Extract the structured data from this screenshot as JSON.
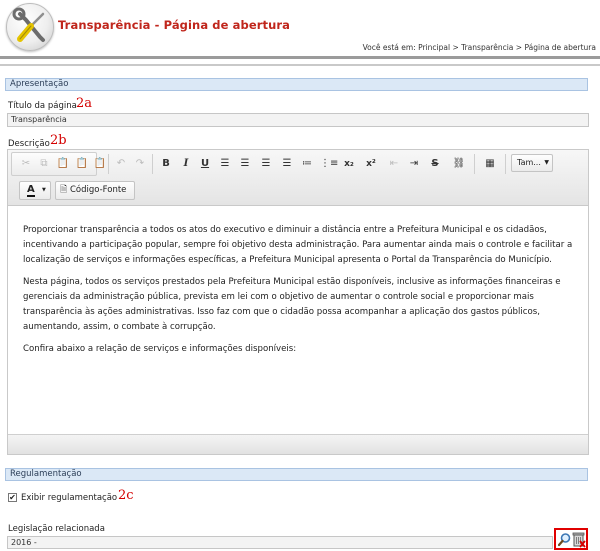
{
  "header": {
    "title": "Transparência - Página de abertura",
    "breadcrumb": "Você está em: Principal > Transparência > Página de abertura"
  },
  "sections": {
    "apresentacao": "Apresentação",
    "regulamentacao": "Regulamentação"
  },
  "titulo": {
    "label": "Título da página",
    "value": "Transparência",
    "annotation": "2a"
  },
  "descricao": {
    "label": "Descrição",
    "annotation": "2b"
  },
  "toolbar": {
    "font_size_label": "Tam...",
    "source_label": "Código-Fonte",
    "font_color_label": "A"
  },
  "content": {
    "p1": "Proporcionar transparência a todos os atos do executivo e diminuir a distância entre a Prefeitura Municipal e os cidadãos, incentivando a participação popular, sempre foi objetivo desta administração. Para aumentar ainda mais o controle e facilitar a localização de serviços e informações específicas, a Prefeitura Municipal apresenta o Portal da Transparência do Município.",
    "p2": "Nesta página, todos os serviços prestados pela Prefeitura Municipal estão disponíveis, inclusive as informações financeiras e gerenciais da administração pública, prevista em lei com o objetivo de aumentar o controle social e proporcionar mais transparência às ações administrativas. Isso faz com que o cidadão possa acompanhar a aplicação dos gastos públicos, aumentando, assim, o combate à corrupção.",
    "p3": "Confira abaixo a relação de serviços e informações disponíveis:"
  },
  "regulamentacao": {
    "checkbox_label": "Exibir regulamentação",
    "checked": true,
    "annotation": "2c",
    "legislacao_label": "Legislação relacionada",
    "legislacao_value": "2016 -"
  },
  "colors": {
    "title": "#c0261c",
    "section_bar": "#dbe8f6",
    "annotation": "#d40000",
    "highlight_box": "#e00000"
  },
  "icons": [
    "tools-icon",
    "cut-icon",
    "copy-icon",
    "paste-icon",
    "paste-text-icon",
    "paste-word-icon",
    "undo-icon",
    "redo-icon",
    "bold-icon",
    "italic-icon",
    "underline-icon",
    "align-left-icon",
    "align-center-icon",
    "align-right-icon",
    "justify-icon",
    "bullet-list-icon",
    "numbered-list-icon",
    "subscript-icon",
    "superscript-icon",
    "outdent-icon",
    "indent-icon",
    "strikethrough-icon",
    "link-icon",
    "table-icon",
    "source-icon",
    "search-icon",
    "delete-icon"
  ]
}
